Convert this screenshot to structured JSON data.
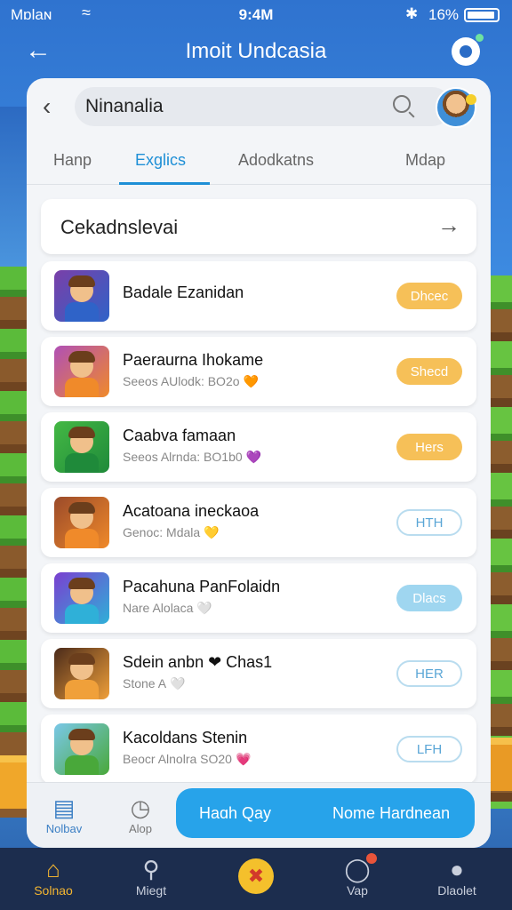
{
  "status_bar": {
    "carrier": "Mɒlaɴ",
    "time": "9:4M",
    "battery": "16%"
  },
  "header": {
    "title": "Imoit Undcasia",
    "back_icon": "arrow-left-icon"
  },
  "search": {
    "value": "Ninanalia",
    "back_icon": "chevron-left-icon"
  },
  "tabs": [
    {
      "label": "Hanp",
      "active": false
    },
    {
      "label": "Exglics",
      "active": true
    },
    {
      "label": "Adodkatns",
      "active": false
    },
    {
      "label": "Mdap",
      "active": false
    }
  ],
  "category": {
    "label": "Cekadnslevai"
  },
  "games": [
    {
      "title": "Badale Ezanidan",
      "subtitle": "",
      "emoji": "",
      "button": "Dhcec",
      "button_style": "orange",
      "icon_colors": [
        "#7a3fa8",
        "#2f63c8"
      ]
    },
    {
      "title": "Paeraurna Ihokame",
      "subtitle": "Seeos AUlodk: BO2o",
      "emoji": "🧡",
      "button": "Shecd",
      "button_style": "orange",
      "icon_colors": [
        "#b04fb6",
        "#f08a2a"
      ]
    },
    {
      "title": "Caabva famaan",
      "subtitle": "Seeos Alrnda: BO1b0",
      "emoji": "💜",
      "button": "Hers",
      "button_style": "orange",
      "icon_colors": [
        "#44b844",
        "#1f8a3a"
      ]
    },
    {
      "title": "Acatoana ineckaoa",
      "subtitle": "Genoc: Mdala",
      "emoji": "💛",
      "button": "HTH",
      "button_style": "outline",
      "icon_colors": [
        "#9a4a2a",
        "#f08a2a"
      ]
    },
    {
      "title": "Pacahuna PanFolaidn",
      "subtitle": "Nare Alolaca",
      "emoji": "🤍",
      "button": "Dlacs",
      "button_style": "blue",
      "icon_colors": [
        "#7a3fd0",
        "#2fb0d8"
      ]
    },
    {
      "title": "Sdein anbn ❤ Chas1",
      "subtitle": "Stone A",
      "emoji": "🤍",
      "button": "HER",
      "button_style": "outline",
      "icon_colors": [
        "#4a2a1a",
        "#f0a03a"
      ]
    },
    {
      "title": "Kacoldans Stenin",
      "subtitle": "Beocr Alnolra SO20",
      "emoji": "💗",
      "button": "LFH",
      "button_style": "outline",
      "icon_colors": [
        "#7ac8e8",
        "#49a83a"
      ]
    }
  ],
  "bottom_panel": {
    "tabs": [
      {
        "label": "Nolbav",
        "icon": "document-icon"
      },
      {
        "label": "Alop",
        "icon": "clock-icon"
      }
    ],
    "cta_left": "Haɑh Qay",
    "cta_right": "Nome Hardnean"
  },
  "nav": [
    {
      "label": "Solnao",
      "icon": "home-icon",
      "active": true
    },
    {
      "label": "Miegt",
      "icon": "search-icon",
      "active": false
    },
    {
      "label": "",
      "icon": "play-icon",
      "active": false
    },
    {
      "label": "Vap",
      "icon": "chat-icon",
      "active": false
    },
    {
      "label": "Dlaolet",
      "icon": "profile-icon",
      "active": false
    }
  ],
  "colors": {
    "accent": "#1e8fd6",
    "cta": "#27a3ea",
    "nav_bg": "#1c2d4e",
    "nav_active": "#f3b531"
  }
}
